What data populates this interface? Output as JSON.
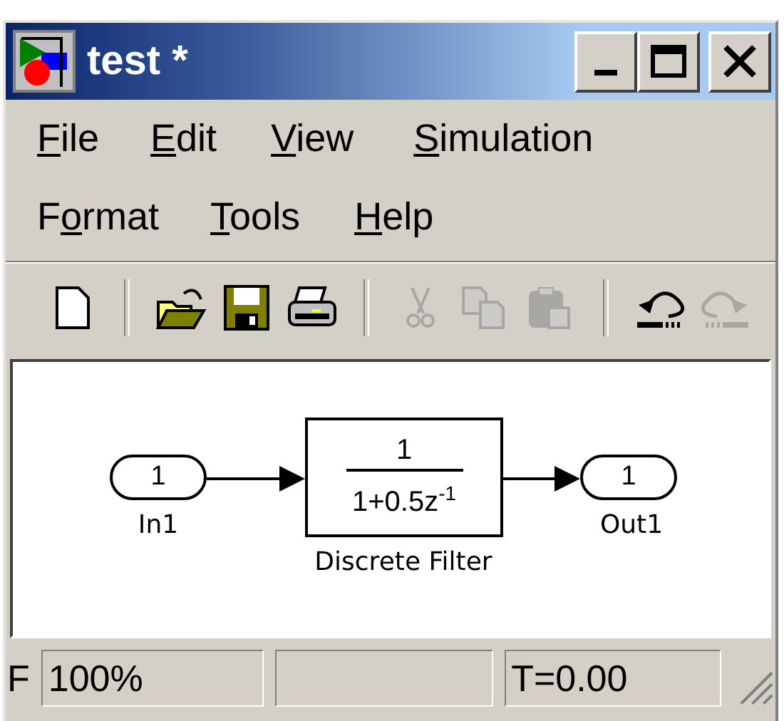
{
  "window": {
    "title": "test *"
  },
  "menu_rows": [
    [
      {
        "label_parts": [
          {
            "text": "F",
            "underlined": true
          },
          {
            "text": "ile",
            "underlined": false
          }
        ]
      },
      {
        "label_parts": [
          {
            "text": "E",
            "underlined": true
          },
          {
            "text": "dit",
            "underlined": false
          }
        ]
      },
      {
        "label_parts": [
          {
            "text": "V",
            "underlined": true
          },
          {
            "text": "iew",
            "underlined": false
          }
        ]
      },
      {
        "label_parts": [
          {
            "text": "S",
            "underlined": true
          },
          {
            "text": "imulation",
            "underlined": false
          }
        ]
      }
    ],
    [
      {
        "label_parts": [
          {
            "text": "F",
            "underlined": false
          },
          {
            "text": "o",
            "underlined": true
          },
          {
            "text": "rmat",
            "underlined": false
          }
        ]
      },
      {
        "label_parts": [
          {
            "text": "T",
            "underlined": true
          },
          {
            "text": "ools",
            "underlined": false
          }
        ]
      },
      {
        "label_parts": [
          {
            "text": "H",
            "underlined": true
          },
          {
            "text": "elp",
            "underlined": false
          }
        ]
      }
    ]
  ],
  "toolbar": [
    {
      "kind": "new",
      "disabled": false
    },
    {
      "kind": "separator"
    },
    {
      "kind": "open",
      "disabled": false
    },
    {
      "kind": "save",
      "disabled": false
    },
    {
      "kind": "print",
      "disabled": false
    },
    {
      "kind": "separator"
    },
    {
      "kind": "cut",
      "disabled": true
    },
    {
      "kind": "copy",
      "disabled": true
    },
    {
      "kind": "paste",
      "disabled": true
    },
    {
      "kind": "separator"
    },
    {
      "kind": "undo",
      "disabled": false
    },
    {
      "kind": "redo",
      "disabled": true
    }
  ],
  "diagram": {
    "inport": {
      "number": "1",
      "label": "In1"
    },
    "block": {
      "numerator": "1",
      "denominator": "1+0.5z$^{-1}$",
      "label": "Discrete Filter"
    },
    "outport": {
      "number": "1",
      "label": "Out1"
    }
  },
  "status_bar": {
    "cut_text": "F",
    "zoom": "100%",
    "time": "T=0.00"
  }
}
